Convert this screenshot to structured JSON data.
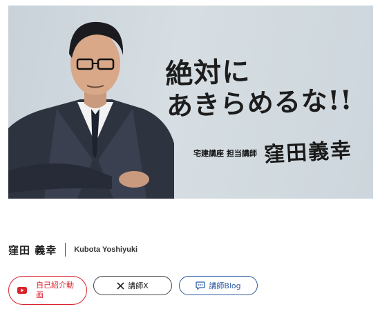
{
  "hero": {
    "slogan_line1": "絶対に",
    "slogan_line2": "あきらめるな!!",
    "role": "宅建講座 担当講師",
    "signature": "窪田義幸"
  },
  "profile": {
    "name_ja": "窪田 義幸",
    "name_en": "Kubota Yoshiyuki"
  },
  "buttons": {
    "video_label": "自己紹介動画",
    "x_label": "講師X",
    "blog_label": "講師Blog"
  },
  "colors": {
    "video": "#d9232d",
    "x": "#444444",
    "blog": "#2c5aa0"
  },
  "icons": {
    "video": "youtube-icon",
    "x": "x-logo-icon",
    "blog": "chat-bubble-icon"
  }
}
